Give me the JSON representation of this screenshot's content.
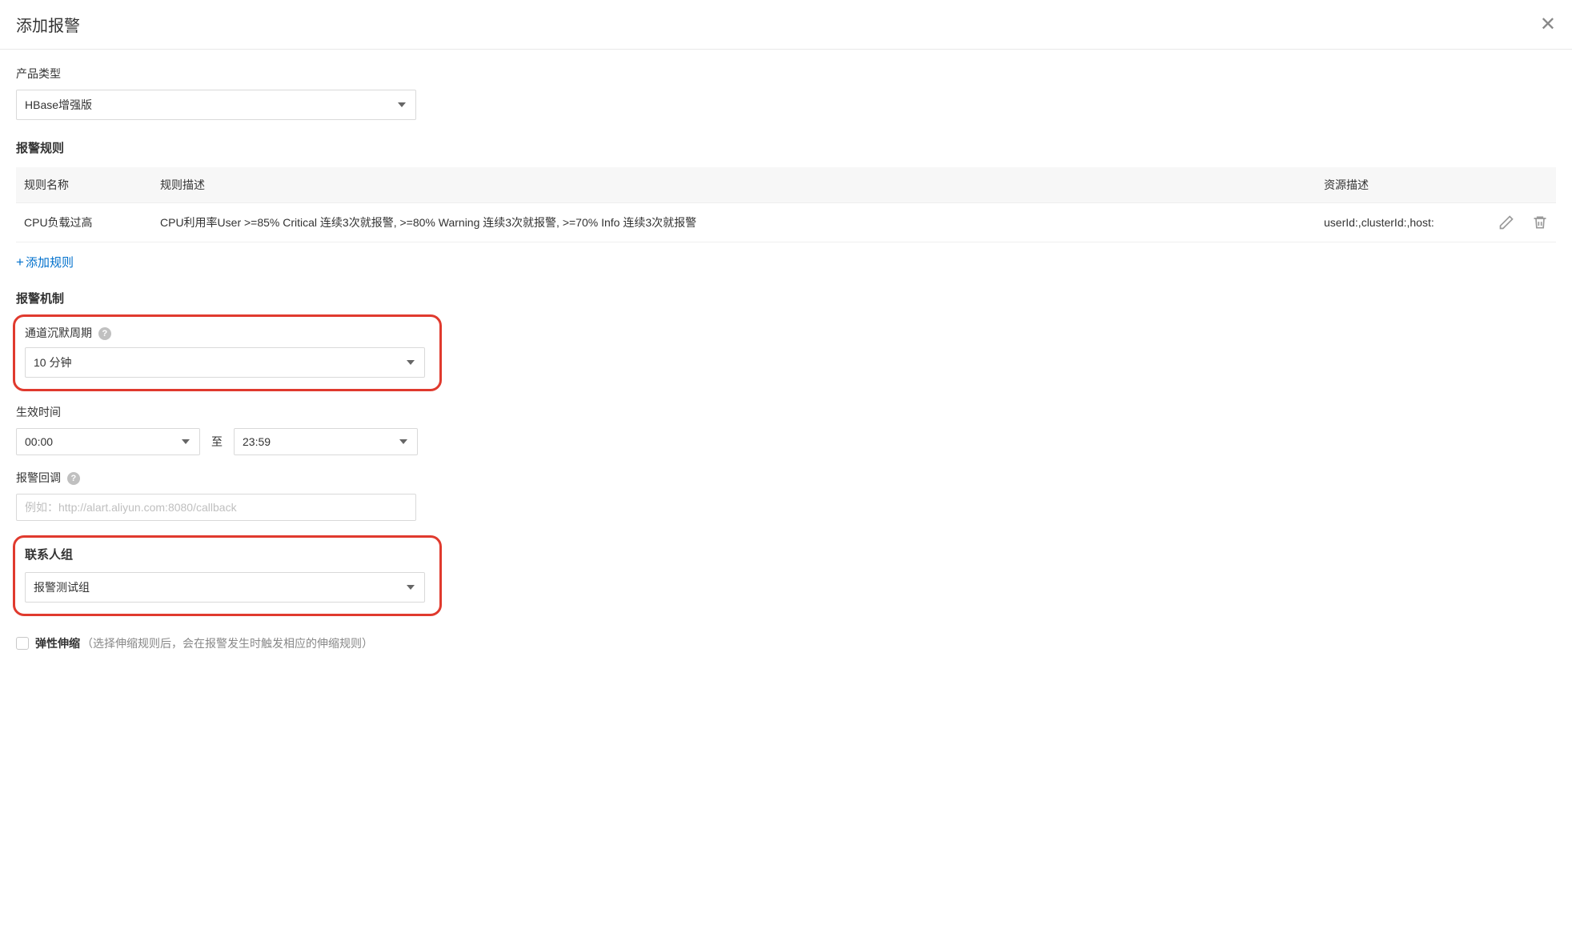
{
  "modal": {
    "title": "添加报警"
  },
  "productType": {
    "label": "产品类型",
    "value": "HBase增强版"
  },
  "alarmRules": {
    "heading": "报警规则",
    "columns": {
      "name": "规则名称",
      "desc": "规则描述",
      "resource": "资源描述"
    },
    "rows": [
      {
        "name": "CPU负载过高",
        "desc": "CPU利用率User >=85% Critical 连续3次就报警, >=80% Warning 连续3次就报警, >=70% Info 连续3次就报警",
        "resource": "userId:,clusterId:,host:"
      }
    ],
    "addLink": "添加规则"
  },
  "alarmMechanism": {
    "heading": "报警机制",
    "silencePeriod": {
      "label": "通道沉默周期",
      "value": "10 分钟"
    },
    "effectiveTime": {
      "label": "生效时间",
      "start": "00:00",
      "sep": "至",
      "end": "23:59"
    },
    "callback": {
      "label": "报警回调",
      "placeholder": "例如：http://alart.aliyun.com:8080/callback"
    }
  },
  "contactGroup": {
    "heading": "联系人组",
    "value": "报警测试组"
  },
  "elasticScaling": {
    "label": "弹性伸缩",
    "hint": "（选择伸缩规则后，会在报警发生时触发相应的伸缩规则）"
  }
}
